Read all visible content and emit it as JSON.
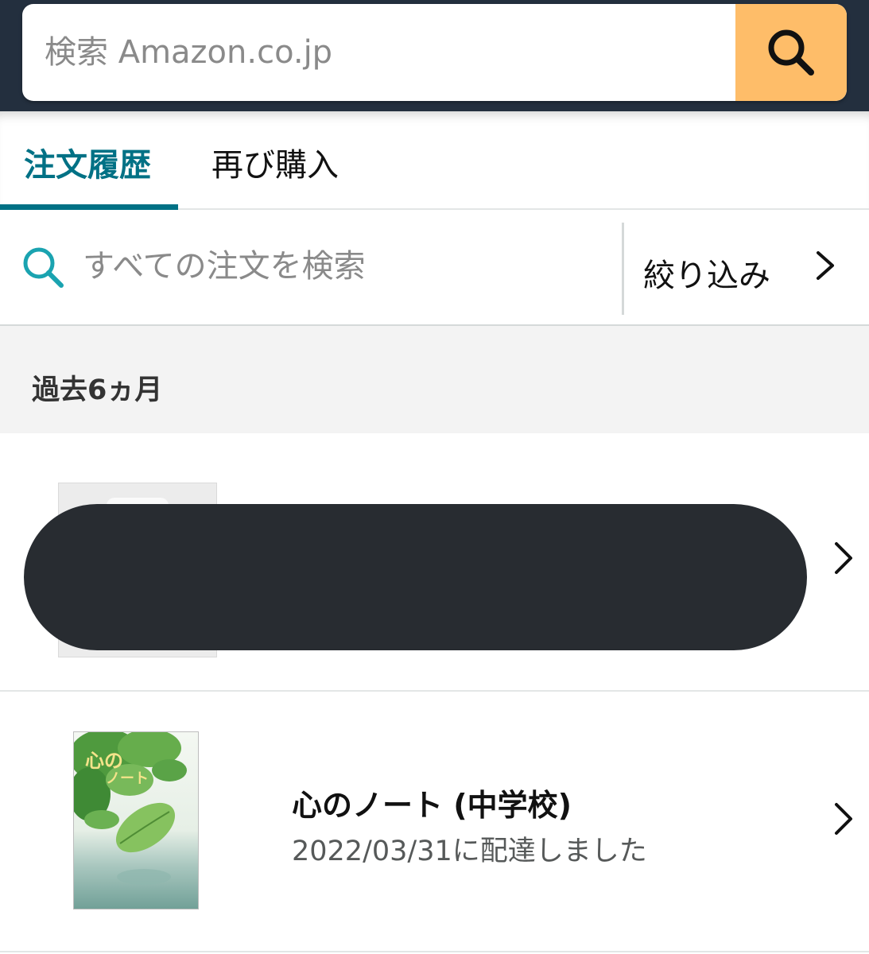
{
  "header": {
    "search_placeholder": "検索 Amazon.co.jp",
    "search_button_icon": "search-icon"
  },
  "tabs": [
    {
      "label": "注文履歴",
      "active": true
    },
    {
      "label": "再び購入",
      "active": false
    }
  ],
  "order_search": {
    "placeholder": "すべての注文を検索",
    "icon": "search-icon"
  },
  "filter": {
    "label": "絞り込み",
    "icon": "chevron-right-icon"
  },
  "period": {
    "label": "過去6ヵ月"
  },
  "orders": [
    {
      "redacted": true
    },
    {
      "title": "心のノート (中学校)",
      "status": "2022/03/31に配達しました",
      "thumbnail": "book-cover-image"
    }
  ],
  "colors": {
    "header_bg": "#232f3e",
    "search_button": "#febd69",
    "accent_teal": "#007185",
    "section_bg": "#f3f3f3"
  }
}
